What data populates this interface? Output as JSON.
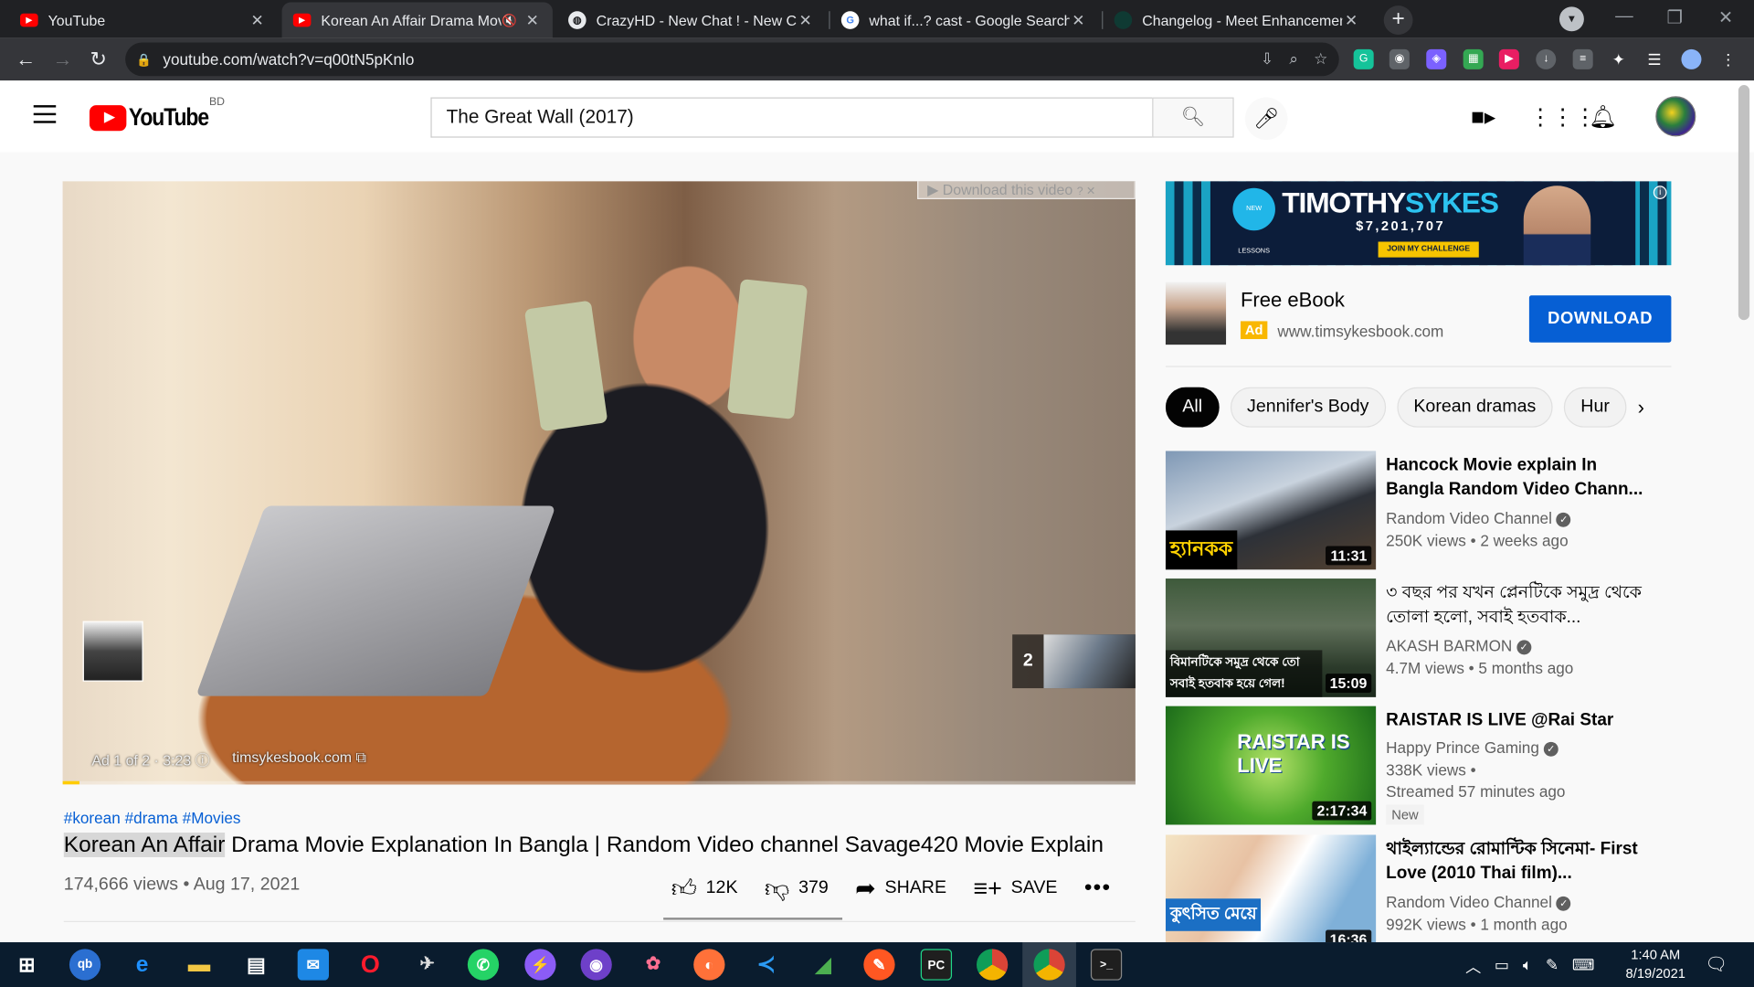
{
  "browser": {
    "tabs": [
      {
        "title": "YouTube",
        "active": false
      },
      {
        "title": "Korean An Affair Drama Mov",
        "active": true
      },
      {
        "title": "CrazyHD - New Chat ! - New Cha",
        "active": false
      },
      {
        "title": "what if...? cast - Google Search",
        "active": false
      },
      {
        "title": "Changelog - Meet Enhancement",
        "active": false
      }
    ],
    "url": "youtube.com/watch?v=q00tN5pKnlo"
  },
  "youtube": {
    "logo_text": "YouTube",
    "country_code": "BD",
    "search_value": "The Great Wall (2017)"
  },
  "player": {
    "download_overlay": "Download this video",
    "ad_counter": "Ad 1 of 2 · 3:23",
    "ad_domain": "timsykesbook.com",
    "next_ad_number": "2",
    "ad_progress": 0.016
  },
  "video": {
    "hashtags": [
      "#korean",
      "#drama",
      "#Movies"
    ],
    "title_highlight": "Korean An Affair",
    "title_rest": " Drama Movie Explanation In Bangla | Random Video channel Savage420 Movie Explain",
    "views_date": "174,666 views • Aug 17, 2021",
    "likes": "12K",
    "dislikes": "379",
    "share_label": "SHARE",
    "save_label": "SAVE"
  },
  "banner": {
    "name_first": "TIMOTHY",
    "name_last": "SYKES",
    "amount": "$7,201,707",
    "badge": "NEW LESSONS WEEKLY",
    "cta": "JOIN MY CHALLENGE"
  },
  "ad_card": {
    "title": "Free eBook",
    "ad_tag": "Ad",
    "url": "www.timsykesbook.com",
    "button": "DOWNLOAD"
  },
  "chips": [
    "All",
    "Jennifer's Body",
    "Korean dramas",
    "Hur"
  ],
  "recommendations": [
    {
      "title": "Hancock Movie explain In Bangla Random Video Chann...",
      "channel": "Random Video Channel",
      "meta": "250K views • 2 weeks ago",
      "duration": "11:31",
      "thumb_caption": "হ্যানকক"
    },
    {
      "title": "৩ বছর পর যখন প্লেনটিকে সমুদ্র থেকে তোলা হলো, সবাই হতবাক...",
      "channel": "AKASH BARMON",
      "meta": "4.7M views • 5 months ago",
      "duration": "15:09",
      "thumb_caption": "বিমানটিকে সমুদ্র থেকে তো সবাই হতবাক হয়ে গেল!"
    },
    {
      "title": "RAISTAR IS LIVE @Rai Star",
      "channel": "Happy Prince Gaming",
      "meta": "338K views •",
      "meta2": "Streamed 57 minutes ago",
      "badge": "New",
      "duration": "2:17:34",
      "thumb_caption": "RAISTAR IS LIVE"
    },
    {
      "title": "থাইল্যান্ডের রোমান্টিক সিনেমা- First Love (2010 Thai film)...",
      "channel": "Random Video Channel",
      "meta": "992K views • 1 month ago",
      "duration": "16:36",
      "thumb_caption": "কুৎসিত মেয়ে"
    }
  ],
  "taskbar": {
    "time": "1:40 AM",
    "date": "8/19/2021"
  }
}
